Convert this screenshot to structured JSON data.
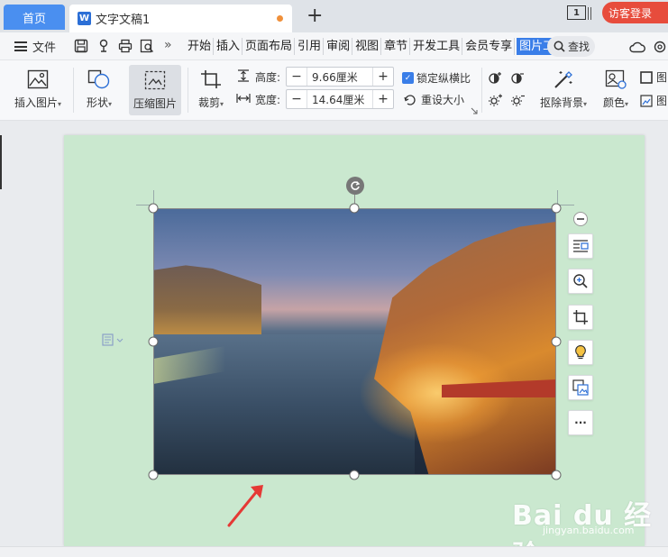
{
  "tabs": {
    "home": "首页",
    "document": "文字文稿1",
    "add": "+"
  },
  "window_count": "1",
  "user": {
    "visitor_login": "访客登录"
  },
  "menu": {
    "file": "文件",
    "more": "»",
    "tabs": [
      "开始",
      "插入",
      "页面布局",
      "引用",
      "审阅",
      "视图",
      "章节",
      "开发工具",
      "会员专享",
      "图片工具"
    ],
    "active_tab": "图片工具",
    "search": "查找"
  },
  "ribbon": {
    "insert_picture": "插入图片",
    "shape": "形状",
    "compress_picture": "压缩图片",
    "crop": "裁剪",
    "height_label": "高度:",
    "height_value": "9.66厘米",
    "width_label": "宽度:",
    "width_value": "14.64厘米",
    "lock_ratio": "锁定纵横比",
    "reset_size": "重设大小",
    "remove_background": "抠除背景",
    "color": "颜色",
    "dropdown_arrow": "▾",
    "truncated_right_1": "图",
    "truncated_right_2": "图"
  },
  "stepper": {
    "minus": "−",
    "plus": "+"
  },
  "side_tools": {
    "more": "···"
  },
  "watermark": {
    "logo": "Bai du 经验",
    "url": "jingyan.baidu.com"
  },
  "colors": {
    "accent": "#3a7ee8",
    "page_bg": "#cae8cf",
    "visitor_badge": "#e74c3c",
    "arrow": "#e53935"
  }
}
